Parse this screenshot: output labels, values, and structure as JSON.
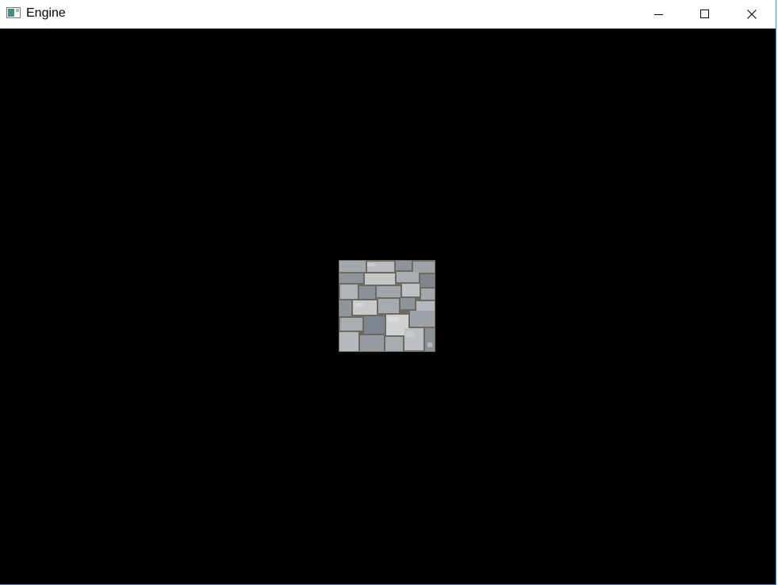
{
  "window": {
    "title": "Engine",
    "icon": "application-window-icon",
    "controls": {
      "minimize": "minimize-icon",
      "maximize": "maximize-icon",
      "close": "close-icon"
    }
  },
  "viewport": {
    "background": "#000000",
    "object": "stone-wall-texture"
  },
  "colors": {
    "titlebar": "#ffffff",
    "window_border": "#4a8fd6",
    "stone_base": "#8e949b",
    "mortar": "#6f6a60"
  }
}
